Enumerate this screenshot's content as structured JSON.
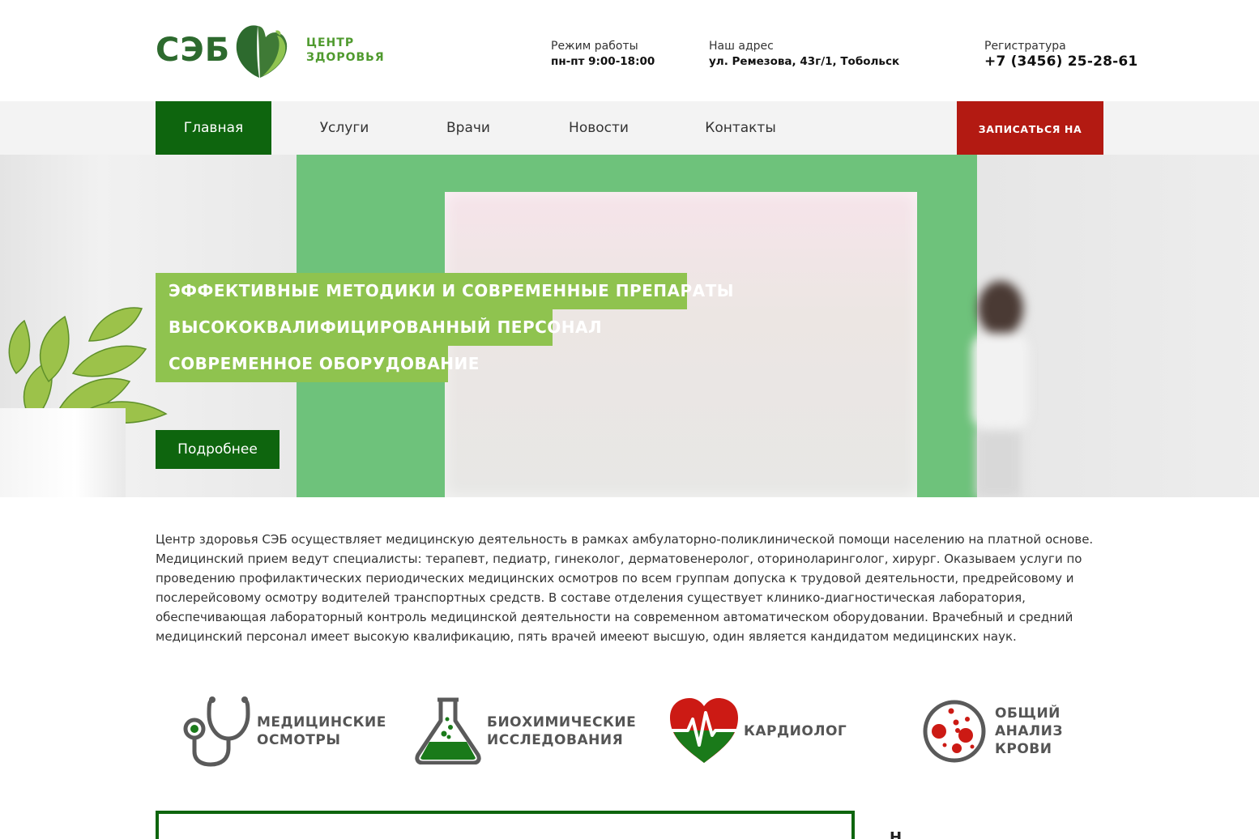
{
  "header": {
    "logo_main": "СЭБ",
    "logo_sub_line1": "ЦЕНТР",
    "logo_sub_line2": "ЗДОРОВЬЯ",
    "work_label": "Режим работы",
    "work_value": "пн-пт 9:00-18:00",
    "address_label": "Наш адрес",
    "address_value": "ул. Ремезова, 43г/1, Тобольск",
    "phone_label": "Регистратура",
    "phone_value": "+7 (3456) 25-28-61"
  },
  "nav": {
    "items": [
      {
        "label": "Главная",
        "active": true
      },
      {
        "label": "Услуги",
        "active": false
      },
      {
        "label": "Врачи",
        "active": false
      },
      {
        "label": "Новости",
        "active": false
      },
      {
        "label": "Контакты",
        "active": false
      }
    ],
    "book_button": "ЗАПИСАТЬСЯ НА ПРИЕМ"
  },
  "hero": {
    "taglines": [
      "ЭФФЕКТИВНЫЕ МЕТОДИКИ И СОВРЕМЕННЫЕ ПРЕПАРАТЫ",
      "ВЫСОКОКВАЛИФИЦИРОВАННЫЙ ПЕРСОНАЛ",
      "СОВРЕМЕННОЕ ОБОРУДОВАНИЕ"
    ],
    "more_button": "Подробнее"
  },
  "about": {
    "lines": [
      "Центр здоровья СЭБ осуществляет медицинскую деятельность в рамках амбулаторно-поликлинической помощи населению на платной основе.",
      "Медицинский прием ведут специалисты: терапевт, педиатр, гинеколог, дерматовенеролог, оториноларинголог, хирург. Оказываем услуги по",
      "проведению профилактических периодических медицинских осмотров по всем группам допуска к трудовой деятельности, предрейсовому и",
      "послерейсовому осмотру водителей транспортных средств. В составе отделения существует клинико-диагностическая лаборатория,",
      "обеспечивающая лабораторный контроль медицинской деятельности на современном автоматическом оборудовании. Врачебный и средний",
      "медицинский персонал имеет высокую квалификацию, пять врачей имееют высшую, один является кандидатом медицинских наук."
    ]
  },
  "features": [
    {
      "icon": "stethoscope-icon",
      "line1": "МЕДИЦИНСКИЕ",
      "line2": "ОСМОТРЫ",
      "line3": ""
    },
    {
      "icon": "flask-icon",
      "line1": "БИОХИМИЧЕСКИЕ",
      "line2": "ИССЛЕДОВАНИЯ",
      "line3": ""
    },
    {
      "icon": "heart-pulse-icon",
      "line1": "КАРДИОЛОГ",
      "line2": "",
      "line3": ""
    },
    {
      "icon": "blood-cells-icon",
      "line1": "ОБЩИЙ",
      "line2": "АНАЛИЗ",
      "line3": "КРОВИ"
    }
  ],
  "bottom": {
    "side_char": "Н"
  },
  "colors": {
    "primary_green": "#0e650e",
    "light_green": "#8fc34f",
    "book_red": "#b31a12",
    "nav_bg": "#f3f3f3"
  }
}
